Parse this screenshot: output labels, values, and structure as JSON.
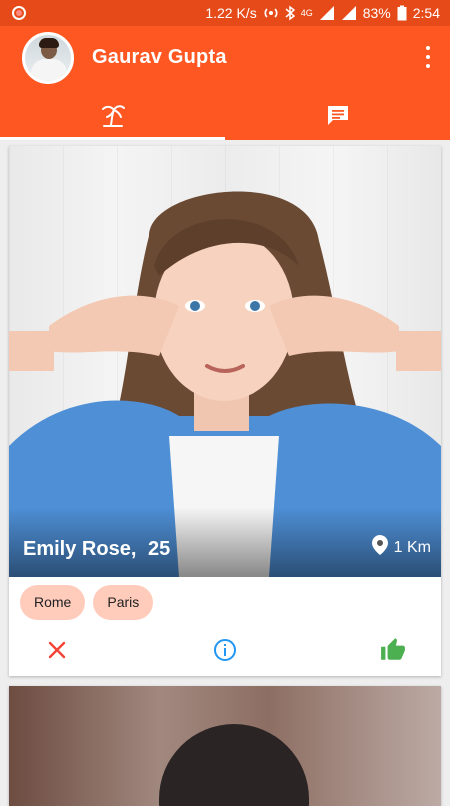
{
  "status_bar": {
    "speed": "1.22 K/s",
    "network": "4G",
    "battery": "83%",
    "time": "2:54"
  },
  "app_bar": {
    "username": "Gaurav Gupta",
    "tabs": [
      {
        "icon": "palm-tree-icon",
        "active": true
      },
      {
        "icon": "chat-icon",
        "active": false
      }
    ]
  },
  "cards": [
    {
      "name": "Emily Rose,",
      "age": "25",
      "distance": "1 Km",
      "tags": [
        "Rome",
        "Paris"
      ],
      "actions": {
        "dislike_icon": "close-icon",
        "info_icon": "info-icon",
        "like_icon": "thumbs-up-icon"
      }
    }
  ],
  "colors": {
    "primary": "#ff5722",
    "primary_dark": "#e64a19",
    "tag_bg": "#ffccbc",
    "dislike": "#f44336",
    "info": "#2196f3",
    "like": "#4caf50"
  }
}
